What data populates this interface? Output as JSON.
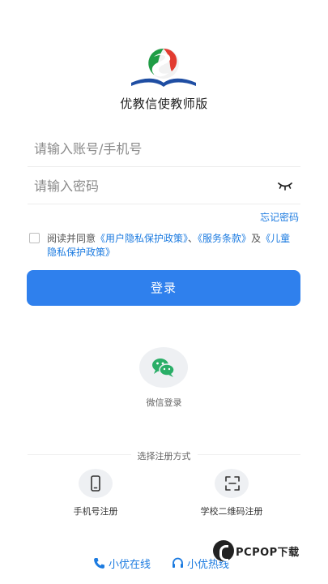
{
  "app": {
    "name": "优教信使教师版"
  },
  "form": {
    "account_placeholder": "请输入账号/手机号",
    "password_placeholder": "请输入密码",
    "forgot_label": "忘记密码"
  },
  "agreement": {
    "prefix": "阅读并同意",
    "privacy_link": "《用户隐私保护政策》",
    "sep1": "、",
    "terms_link": "《服务条款》",
    "sep2": "及",
    "child_link": "《儿童隐私保护政策》"
  },
  "login_label": "登录",
  "wechat_label": "微信登录",
  "register": {
    "title": "选择注册方式",
    "phone_label": "手机号注册",
    "school_label": "学校二维码注册"
  },
  "bottom": {
    "online_label": "小优在线",
    "hotline_label": "小优热线"
  },
  "watermark": {
    "text": "PCPOP下载"
  },
  "colors": {
    "accent": "#2f80ed",
    "link": "#1c7be0",
    "wechat_green": "#2aae67"
  }
}
